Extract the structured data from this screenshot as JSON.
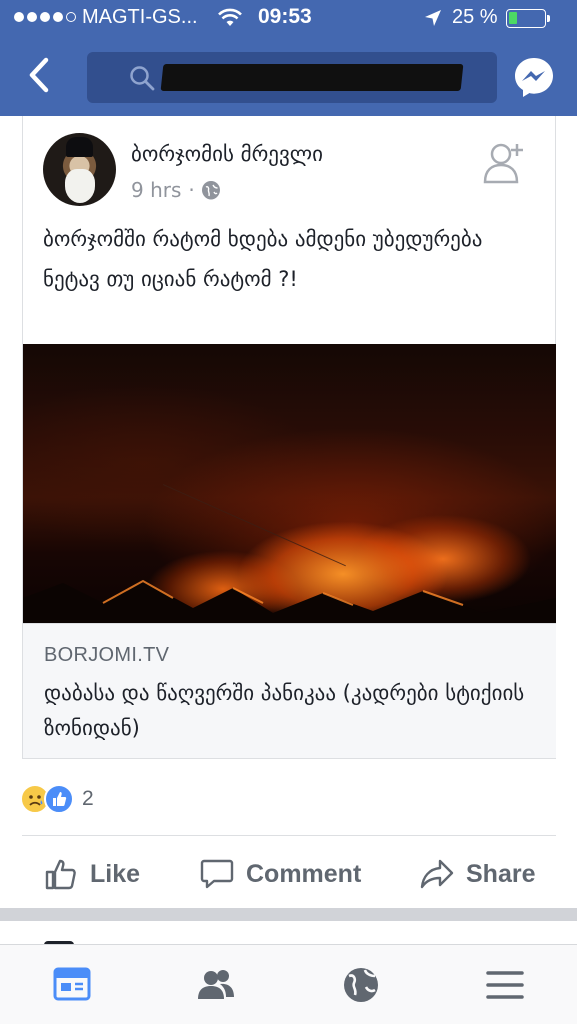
{
  "status_bar": {
    "carrier": "MAGTI-GS...",
    "time": "09:53",
    "battery_percent_text": "25 %",
    "battery_level": 0.25,
    "signal_bars_filled": 4,
    "signal_bars_total": 5
  },
  "nav": {
    "back_icon": "chevron-left-icon",
    "search_icon": "search-icon",
    "messenger_icon": "messenger-icon"
  },
  "post": {
    "author": "ბორჯომის მრევლი",
    "time": "9 hrs",
    "separator": "·",
    "privacy_icon": "globe-icon",
    "text": "ბორჯომში რატომ ხდება ამდენი უბედურება ნეტავ თუ იციან რატომ ?!",
    "link": {
      "domain": "BORJOMI.TV",
      "title": "დაბასა და წაღვერში პანიკაა (კადრები სტიქიის ზონიდან)"
    },
    "reactions": {
      "types": [
        "sad",
        "like"
      ],
      "count": "2"
    },
    "actions": {
      "like": "Like",
      "comment": "Comment",
      "share": "Share"
    }
  },
  "tab_bar": {
    "items": [
      "news-feed-icon",
      "friends-icon",
      "notifications-globe-icon",
      "menu-icon"
    ],
    "active": "news-feed-icon"
  },
  "colors": {
    "brand_blue": "#4468b0",
    "search_bg": "#324f8e",
    "active_tab": "#4b8df8",
    "secondary_text": "#90949c"
  }
}
